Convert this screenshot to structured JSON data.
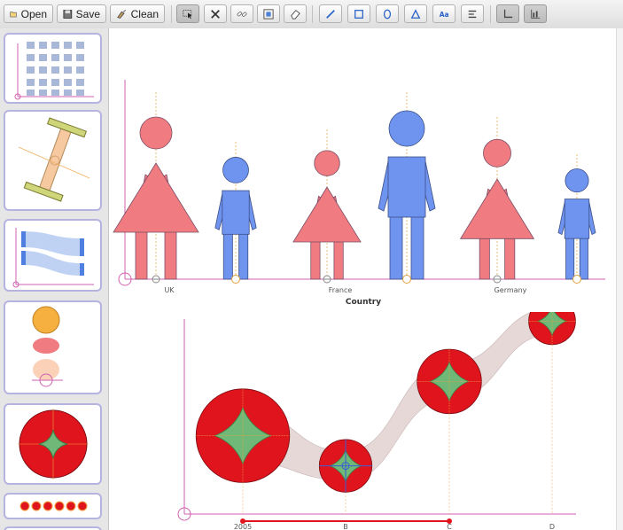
{
  "toolbar": {
    "open_label": "Open",
    "save_label": "Save",
    "clean_label": "Clean",
    "tools": [
      "select-tool",
      "delete-tool",
      "link-tool",
      "group-tool",
      "eraser-tool",
      "line-tool",
      "rect-tool",
      "ellipse-tool",
      "polygon-tool",
      "text-tool",
      "align-tool",
      "axis-tool",
      "chart-tool"
    ]
  },
  "sidebar": {
    "thumbnails": [
      "icon-grid-thumbnail",
      "dumbbell-thumbnail",
      "sankey-thumbnail",
      "stacked-ellipses-thumbnail",
      "glyph-circle-thumbnail",
      "dots-row-thumbnail"
    ]
  },
  "colors": {
    "female": "#f07b80",
    "male": "#6f94ef",
    "bubble": "#e0141d",
    "star": "#6fb877",
    "axis": "#d060b0",
    "band": "#dccbca"
  },
  "chart_data": [
    {
      "type": "pictograph",
      "xlabel": "Country",
      "categories": [
        "UK",
        "France",
        "Germany"
      ],
      "series": [
        {
          "values": [
            2.9,
            2.3,
            2.5
          ]
        },
        {
          "values": [
            2.1,
            2.9,
            1.9
          ]
        }
      ]
    },
    {
      "type": "scatter",
      "categories": [
        "2005",
        "B",
        "C",
        "D"
      ],
      "values": [
        1.3,
        0.8,
        2.2,
        3.2
      ],
      "sizes": [
        1.6,
        0.9,
        1.1,
        0.8
      ]
    }
  ]
}
